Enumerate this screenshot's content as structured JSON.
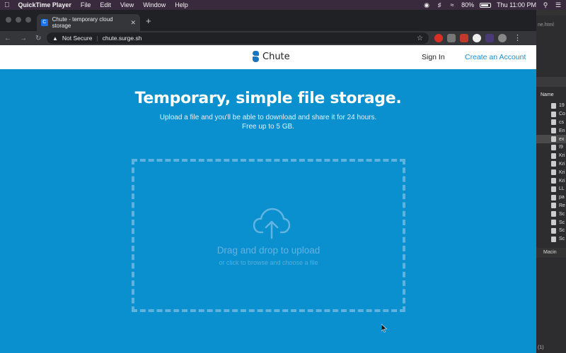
{
  "menubar": {
    "app": "QuickTime Player",
    "items": [
      "File",
      "Edit",
      "View",
      "Window",
      "Help"
    ],
    "battery": "80%",
    "clock": "Thu 11:00 PM"
  },
  "browser": {
    "tab_title": "Chute - temporary cloud storage",
    "tab_favicon": "C",
    "security_label": "Not Secure",
    "url": "chute.surge.sh"
  },
  "site": {
    "logo_text": "Chute",
    "signin": "Sign In",
    "create_account": "Create an Account",
    "hero_title": "Temporary, simple file storage.",
    "hero_line1": "Upload a file and you'll be able to download and share it for 24 hours.",
    "hero_line2": "Free up to 5 GB.",
    "dropzone_title": "Drag and drop to upload",
    "dropzone_sub": "or click to browse and choose a file",
    "colors": {
      "background": "#0a8fcf",
      "accent": "#1b8ed6"
    }
  },
  "finder": {
    "tab_fragment": "ne.html",
    "column_header": "Name",
    "rows": [
      "19",
      "Co",
      "cs",
      "En",
      "ex",
      "I9",
      "Kri",
      "Kri",
      "Kri",
      "Kri",
      "LL",
      "pa",
      "Re",
      "Sc",
      "Sc",
      "Sc",
      "Sc"
    ],
    "volume": "Macin",
    "status": "(1)"
  }
}
